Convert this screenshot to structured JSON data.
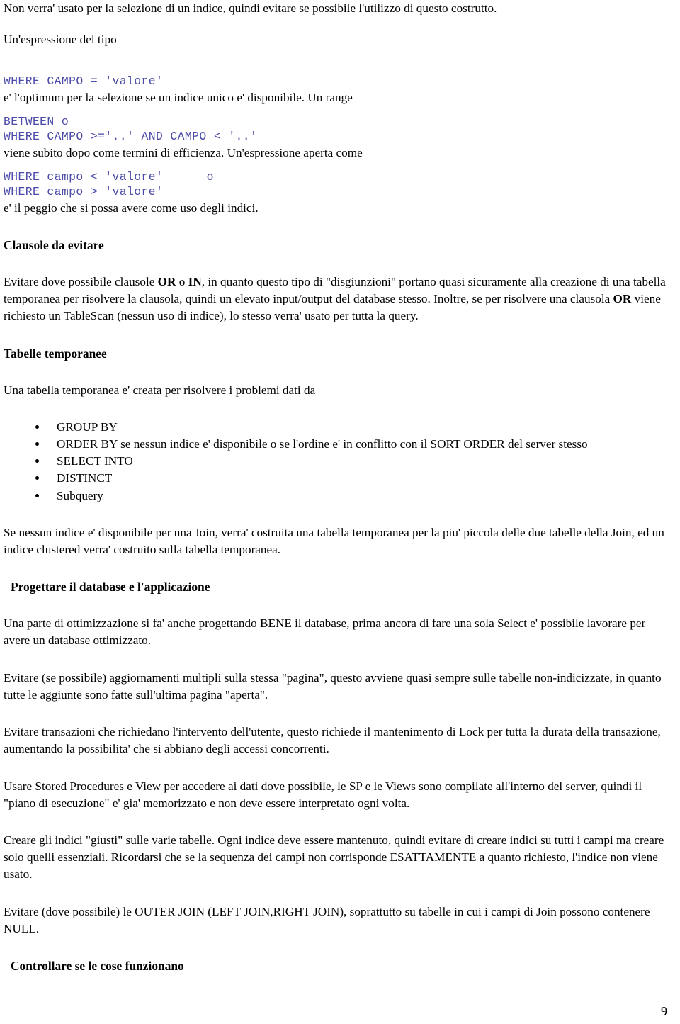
{
  "document": {
    "page_number": "9",
    "code_color": "#4a4aa8",
    "text_color": "#000000",
    "background": "#ffffff"
  },
  "blocks": {
    "intro_paragraph": "Non verra' usato per la selezione di un indice, quindi evitare se possibile l'utilizzo di questo costrutto.",
    "expression_intro": "Un'espressione del tipo",
    "code_1": "WHERE CAMPO = 'valore'",
    "after_code_1": "e' l'optimum per la selezione se un indice unico e' disponibile. Un range",
    "code_2_line_1": "BETWEEN o",
    "code_2_line_2": "WHERE CAMPO >='..' AND CAMPO < '..'",
    "after_code_2": "viene subito dopo come termini di efficienza. Un'espressione aperta come",
    "code_3_line_1": "WHERE campo < 'valore'      o",
    "code_3_line_2": "WHERE campo > 'valore'",
    "after_code_3": "e' il peggio che si possa avere come uso degli indici."
  },
  "sections": {
    "clausole": {
      "heading": "Clausole da evitare",
      "paragraph_part_1": "Evitare dove possibile clausole ",
      "bold_1": "OR",
      "paragraph_part_2": " o ",
      "bold_2": "IN",
      "paragraph_part_3": ", in quanto questo tipo di \"disgiunzioni\" portano quasi sicuramente alla creazione di una tabella temporanea per risolvere la clausola, quindi un elevato input/output del database stesso. Inoltre, se per risolvere una clausola ",
      "bold_3": "OR",
      "paragraph_part_4": " viene richiesto un TableScan (nessun uso di indice), lo stesso verra' usato per tutta la query."
    },
    "tabelle_temporanee": {
      "heading": "Tabelle temporanee",
      "intro": "Una tabella temporanea e' creata per risolvere i problemi dati da",
      "bullets": [
        "GROUP BY",
        "ORDER BY se nessun indice e' disponibile o se l'ordine e' in conflitto con il SORT ORDER del server stesso",
        "SELECT INTO",
        "DISTINCT",
        "Subquery"
      ],
      "closing": "Se nessun indice e' disponibile per una Join, verra' costruita una tabella temporanea per la piu' piccola delle due tabelle della Join, ed un indice clustered verra' costruito sulla tabella temporanea."
    },
    "progettare": {
      "heading": "Progettare il database e l'applicazione",
      "paragraph_1": "Una parte di ottimizzazione si fa' anche progettando BENE il database, prima ancora di fare una sola Select e' possibile lavorare per avere un database ottimizzato.",
      "paragraph_2": "Evitare (se possibile) aggiornamenti multipli sulla stessa \"pagina\", questo avviene quasi sempre sulle tabelle non-indicizzate, in quanto tutte le aggiunte sono fatte sull'ultima pagina \"aperta\".",
      "paragraph_3": "Evitare transazioni che richiedano l'intervento dell'utente, questo richiede il mantenimento di Lock per tutta la durata della transazione, aumentando la possibilita' che si abbiano degli accessi concorrenti.",
      "paragraph_4": "Usare Stored Procedures e View per accedere ai dati dove possibile, le SP e le Views sono compilate all'interno del server, quindi il \"piano di esecuzione\" e' gia' memorizzato e non deve essere interpretato ogni volta.",
      "paragraph_5": "Creare gli indici \"giusti\" sulle varie tabelle. Ogni indice deve essere mantenuto, quindi evitare di creare indici su tutti i campi ma creare solo quelli essenziali. Ricordarsi che se la sequenza dei campi non corrisponde ESATTAMENTE a quanto richiesto, l'indice non viene usato.",
      "paragraph_6": "Evitare (dove possibile) le OUTER JOIN (LEFT JOIN,RIGHT JOIN), soprattutto su tabelle in cui i campi di Join possono contenere NULL."
    },
    "controllare": {
      "heading": "Controllare se le cose funzionano"
    }
  }
}
